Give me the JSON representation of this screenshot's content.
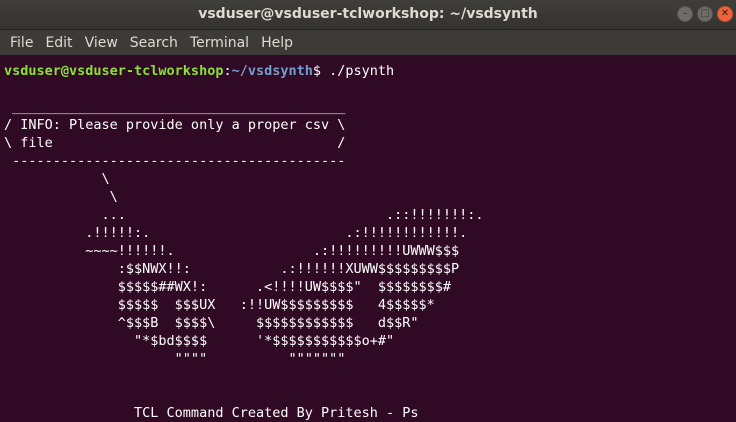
{
  "window": {
    "title": "vsduser@vsduser-tclworkshop: ~/vsdsynth",
    "controls": {
      "minimize": "–",
      "maximize": "□",
      "close": "✕"
    }
  },
  "menu": [
    "File",
    "Edit",
    "View",
    "Search",
    "Terminal",
    "Help"
  ],
  "terminal": {
    "prompt_user_host": "vsduser@vsduser-tclworkshop",
    "prompt_sep": ":",
    "prompt_path": "~/vsdsynth",
    "prompt_symbol": "$ ",
    "command": "./psynth",
    "output_lines": [
      "",
      " _________________________________________",
      "/ INFO: Please provide only a proper csv \\",
      "\\ file                                   /",
      " -----------------------------------------",
      "            \\",
      "             \\",
      "            ...                                .::!!!!!!!:.",
      "          .!!!!!:.                        .:!!!!!!!!!!!!.",
      "          ~~~~!!!!!!.                 .:!!!!!!!!!UWWW$$$",
      "              :$$NWX!!:           .:!!!!!!XUWW$$$$$$$$$P",
      "              $$$$$##WX!:      .<!!!!UW$$$$\"  $$$$$$$$#",
      "              $$$$$  $$$UX   :!!UW$$$$$$$$$   4$$$$$*",
      "              ^$$$B  $$$$\\     $$$$$$$$$$$$   d$$R\"",
      "                \"*$bd$$$$      '*$$$$$$$$$$$o+#\"",
      "                     \"\"\"\"          \"\"\"\"\"\"\"",
      "",
      "",
      "                TCL Command Created By Pritesh - Ps"
    ]
  }
}
